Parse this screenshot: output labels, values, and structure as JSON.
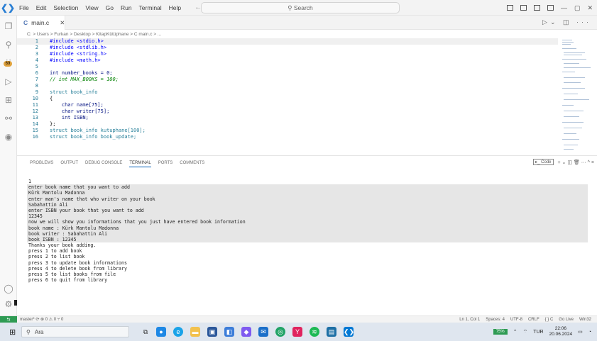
{
  "menu": [
    "File",
    "Edit",
    "Selection",
    "View",
    "Go",
    "Run",
    "Terminal",
    "Help"
  ],
  "search": {
    "label": "Search"
  },
  "tab": {
    "label": "main.c",
    "icon": "C"
  },
  "breadcrumb": "C: > Users > Furkan > Desktop > KitapKütüphane > C main.c > ...",
  "editor": {
    "lines": [
      {
        "n": "1",
        "t": "#include <stdio.h>"
      },
      {
        "n": "2",
        "t": "#include <stdlib.h>"
      },
      {
        "n": "3",
        "t": "#include <string.h>"
      },
      {
        "n": "4",
        "t": "#include <math.h>"
      },
      {
        "n": "5",
        "t": ""
      },
      {
        "n": "6",
        "t": "int number_books = 0;"
      },
      {
        "n": "7",
        "t": "// int MAX_BOOKS = 100;"
      },
      {
        "n": "8",
        "t": ""
      },
      {
        "n": "9",
        "t": "struct book_info"
      },
      {
        "n": "10",
        "t": "{"
      },
      {
        "n": "11",
        "t": "    char name[75];"
      },
      {
        "n": "12",
        "t": "    char writer[75];"
      },
      {
        "n": "13",
        "t": "    int ISBN;"
      },
      {
        "n": "14",
        "t": "};"
      },
      {
        "n": "15",
        "t": "struct book_info kutuphane[100];"
      },
      {
        "n": "16",
        "t": "struct book_info book_update;"
      }
    ]
  },
  "panel": {
    "tabs": [
      "PROBLEMS",
      "OUTPUT",
      "DEBUG CONSOLE",
      "TERMINAL",
      "PORTS",
      "COMMENTS"
    ],
    "active_tab": "TERMINAL",
    "terminal_name": "Code",
    "actions": "+ ⌄ ◫ 🗑 ··· ^ ×"
  },
  "terminal": [
    "1",
    "enter book name that you want to add",
    "Kürk Mantolu Madonna",
    "enter man's name that who writer on your book",
    "Sabahattin Ali",
    "enter ISBN your book that you want to add",
    "12345",
    "now we will show you informations that you just have entered book information",
    "book name : Kürk Mantolu Madonna",
    "book writer : Sabahattin Ali",
    "book ISBN : 12345",
    "Thanks your book adding.",
    "press 1 to add book",
    "press 2 to list book",
    "press 3 to update book informations",
    "press 4 to delete book from library",
    "press 5 to list books from file",
    "press 6 to quit from library"
  ],
  "status": {
    "left": "master*  ⟳  ⊗ 0 ⚠ 0   ⑂ 0",
    "right": [
      "Ln 1, Col 1",
      "Spaces: 4",
      "UTF-8",
      "CRLF",
      "{ } C",
      "Go Live",
      "Win32"
    ]
  },
  "taskbar": {
    "search_label": "Ara",
    "battery": "75%",
    "lang": "TUR",
    "time": "22:06",
    "date": "20.06.2024"
  },
  "colors": {
    "accent": "#005fb8",
    "status_green": "#2e9b53",
    "activity_badge": "#e0a23c"
  }
}
